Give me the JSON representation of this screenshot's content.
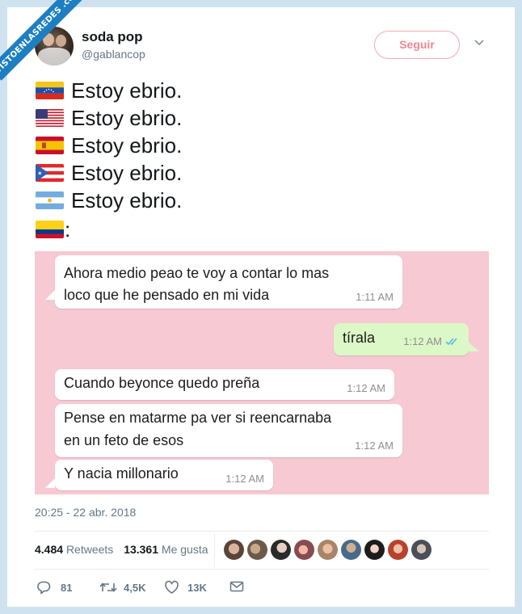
{
  "watermark": "VISTOENLASREDES .com",
  "tweet": {
    "name": "soda pop",
    "handle": "@gablancop",
    "follow_label": "Seguir",
    "lines": [
      {
        "flag": "venezuela",
        "text": "Estoy ebrio."
      },
      {
        "flag": "usa",
        "text": "Estoy ebrio."
      },
      {
        "flag": "spain",
        "text": "Estoy ebrio."
      },
      {
        "flag": "puerto-rico",
        "text": "Estoy ebrio."
      },
      {
        "flag": "argentina",
        "text": "Estoy ebrio."
      },
      {
        "flag": "colombia",
        "text": ":"
      }
    ],
    "timestamp": "20:25 - 22 abr. 2018",
    "retweets_count": "4.484",
    "retweets_label": "Retweets",
    "likes_count": "13.361",
    "likes_label": "Me gusta",
    "actions": {
      "reply": "81",
      "retweet": "4,5K",
      "like": "13K"
    }
  },
  "chat": {
    "messages": [
      {
        "direction": "in",
        "text_lines": [
          "Ahora medio peao te voy a contar lo mas",
          "loco que he pensado en mi vida"
        ],
        "time": "1:11 AM"
      },
      {
        "direction": "out",
        "text": "tírala",
        "time": "1:12 AM",
        "status": "read"
      },
      {
        "direction": "in",
        "text": "Cuando beyonce quedo preña",
        "time": "1:12 AM"
      },
      {
        "direction": "in",
        "text_lines": [
          "Pense en matarme pa ver si reencarnaba",
          "en un feto de esos"
        ],
        "time": "1:12 AM"
      },
      {
        "direction": "in",
        "text": "Y nacia millonario",
        "time": "1:12 AM"
      }
    ]
  },
  "colors": {
    "chat_background": "#f7c9d2",
    "outgoing_bubble": "#dcf8c6",
    "follow_accent": "#f08597",
    "read_ticks": "#4fb6ec"
  }
}
